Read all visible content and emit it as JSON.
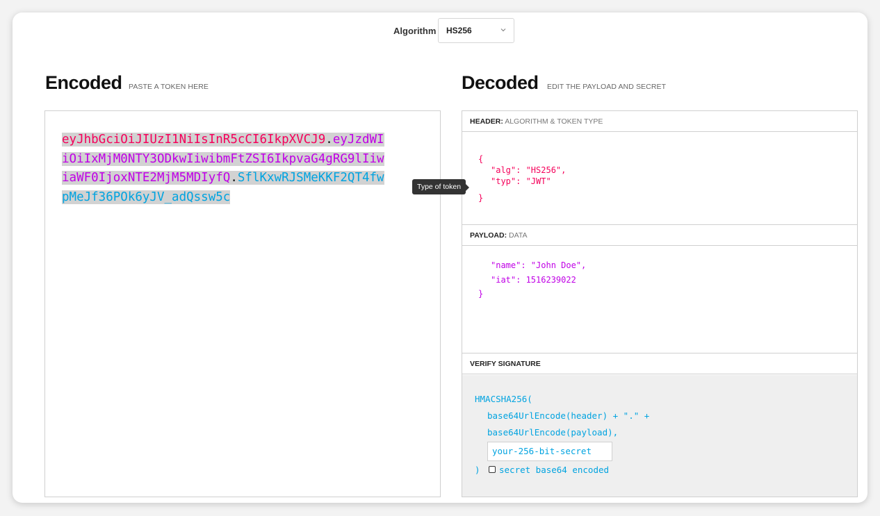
{
  "algorithm": {
    "label": "Algorithm",
    "value": "HS256"
  },
  "encoded": {
    "title": "Encoded",
    "subtitle": "PASTE A TOKEN HERE",
    "header_part": "eyJhbGciOiJIUzI1NiIsInR5cCI6IkpXVCJ9",
    "payload_part": "eyJzdWIiOiIxMjM0NTY3ODkwIiwibmFtZSI6IkpvaG4gRG9lIiwiaWF0IjoxNTE2MjM5MDIyfQ",
    "signature_part": "SflKxwRJSMeKKF2QT4fwpMeJf36POk6yJV_adQssw5c",
    "dot": "."
  },
  "tooltip": "Type of token",
  "decoded": {
    "title": "Decoded",
    "subtitle": "EDIT THE PAYLOAD AND SECRET",
    "header_section": {
      "label": "HEADER:",
      "sublabel": "ALGORITHM & TOKEN TYPE",
      "open": "{",
      "line1": "\"alg\": \"HS256\",",
      "line2": "\"typ\": \"JWT\"",
      "close": "}"
    },
    "payload_section": {
      "label": "PAYLOAD:",
      "sublabel": "DATA",
      "line1": "\"name\": \"John Doe\",",
      "line2": "\"iat\": 1516239022",
      "close": "}"
    },
    "verify_section": {
      "label": "VERIFY SIGNATURE",
      "fn": "HMACSHA256(",
      "line1": "base64UrlEncode(header) + \".\" +",
      "line2": "base64UrlEncode(payload),",
      "secret_value": "your-256-bit-secret",
      "close": ")",
      "checkbox_label": "secret base64 encoded"
    }
  },
  "colors": {
    "header": "#f5005a",
    "payload": "#c000e6",
    "signature": "#00a3e0"
  },
  "icons": {
    "select": "chevron-down-icon"
  }
}
